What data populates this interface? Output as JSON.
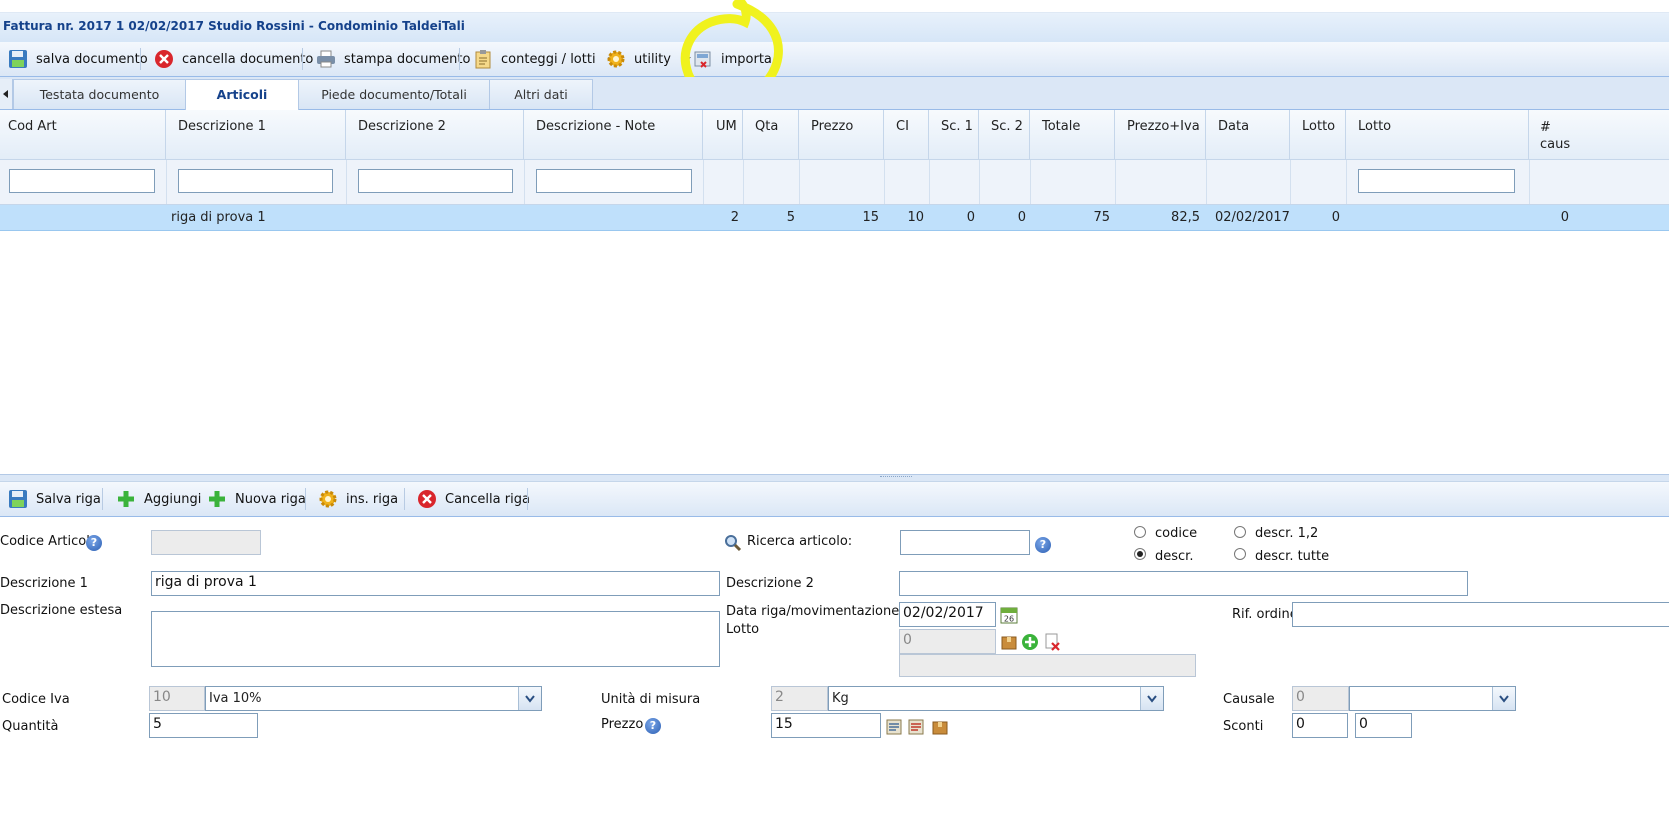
{
  "window": {
    "title": "Fattura nr. 2017 1  02/02/2017 Studio Rossini - Condominio TaldeiTali"
  },
  "toolbar": {
    "save": "salva documento",
    "delete": "cancella documento",
    "print": "stampa documento",
    "counts": "conteggi / lotti",
    "utility": "utility",
    "import": "importa"
  },
  "tabs": [
    "Testata documento",
    "Articoli",
    "Piede documento/Totali",
    "Altri dati"
  ],
  "grid": {
    "columns": [
      "Cod Art",
      "Descrizione 1",
      "Descrizione 2",
      "Descrizione - Note",
      "UM",
      "Qta",
      "Prezzo",
      "CI",
      "Sc. 1",
      "Sc. 2",
      "Totale",
      "Prezzo+Iva",
      "Data",
      "Lotto",
      "Lotto",
      "# caus"
    ],
    "row": {
      "cod_art": "",
      "descr1": "riga di prova 1",
      "um": "2",
      "qta": "5",
      "prezzo": "15",
      "ci": "10",
      "sc1": "0",
      "sc2": "0",
      "totale": "75",
      "prezzo_iva": "82,5",
      "data": "02/02/2017",
      "lotto": "0",
      "caus": "0"
    }
  },
  "row_toolbar": {
    "save": "Salva riga",
    "add": "Aggiungi",
    "new": "Nuova riga",
    "insert": "ins. riga",
    "delete": "Cancella riga"
  },
  "form": {
    "codice_articolo_label": "Codice Articolo",
    "ricerca_label": "Ricerca articolo:",
    "radio_codice": "codice",
    "radio_descr12": "descr. 1,2",
    "radio_descr": "descr.",
    "radio_descr_tutte": "descr. tutte",
    "descr1_label": "Descrizione 1",
    "descr1_value": "riga di prova 1",
    "descr2_label": "Descrizione 2",
    "descr_estesa_label": "Descrizione estesa",
    "data_riga_label": "Data riga/movimentazione",
    "data_riga_value": "02/02/2017",
    "lotto_label": "Lotto",
    "lotto_value": "0",
    "rif_ordine_label": "Rif. ordine",
    "codice_iva_label": "Codice Iva",
    "codice_iva_code": "10",
    "codice_iva_value": "Iva 10%",
    "um_label": "Unità di misura",
    "um_code": "2",
    "um_value": "Kg",
    "causale_label": "Causale",
    "causale_code": "0",
    "quantita_label": "Quantità",
    "quantita_value": "5",
    "prezzo_label": "Prezzo",
    "prezzo_value": "15",
    "sconti_label": "Sconti",
    "sconto1_value": "0",
    "sconto2_value": "0",
    "calendar_day": "26"
  },
  "colors": {
    "highlight": "#f0f21e",
    "selected_row": "#bfe0fb",
    "header_text": "#15428b"
  }
}
